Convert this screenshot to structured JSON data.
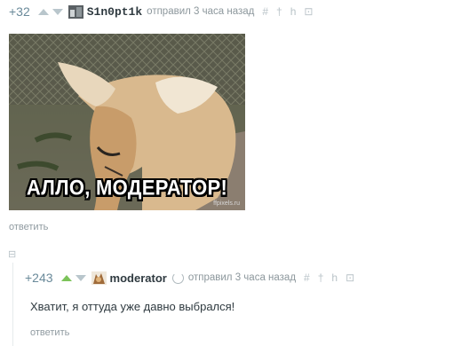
{
  "comment1": {
    "score": "+32",
    "username": "S1n0pt1k",
    "meta": "отправил 3 часа назад",
    "tools": [
      "#",
      "†",
      "h",
      "⊡"
    ],
    "image_caption": "АЛЛО, МОДЕРАТОР!",
    "watermark": "ffpixels.ru",
    "reply_label": "ответить"
  },
  "comment2": {
    "collapse_label": "⊟",
    "score": "+243",
    "username": "moderator",
    "meta": "отправил 3 часа назад",
    "tools": [
      "#",
      "†",
      "h",
      "⊡"
    ],
    "text": "Хватит, я оттуда уже давно выбрался!",
    "reply_label": "ответить"
  },
  "colors": {
    "upvote": "#7cc35a",
    "score": "#6a8a9a",
    "text": "#2f3a40",
    "meta": "#8c979c"
  }
}
